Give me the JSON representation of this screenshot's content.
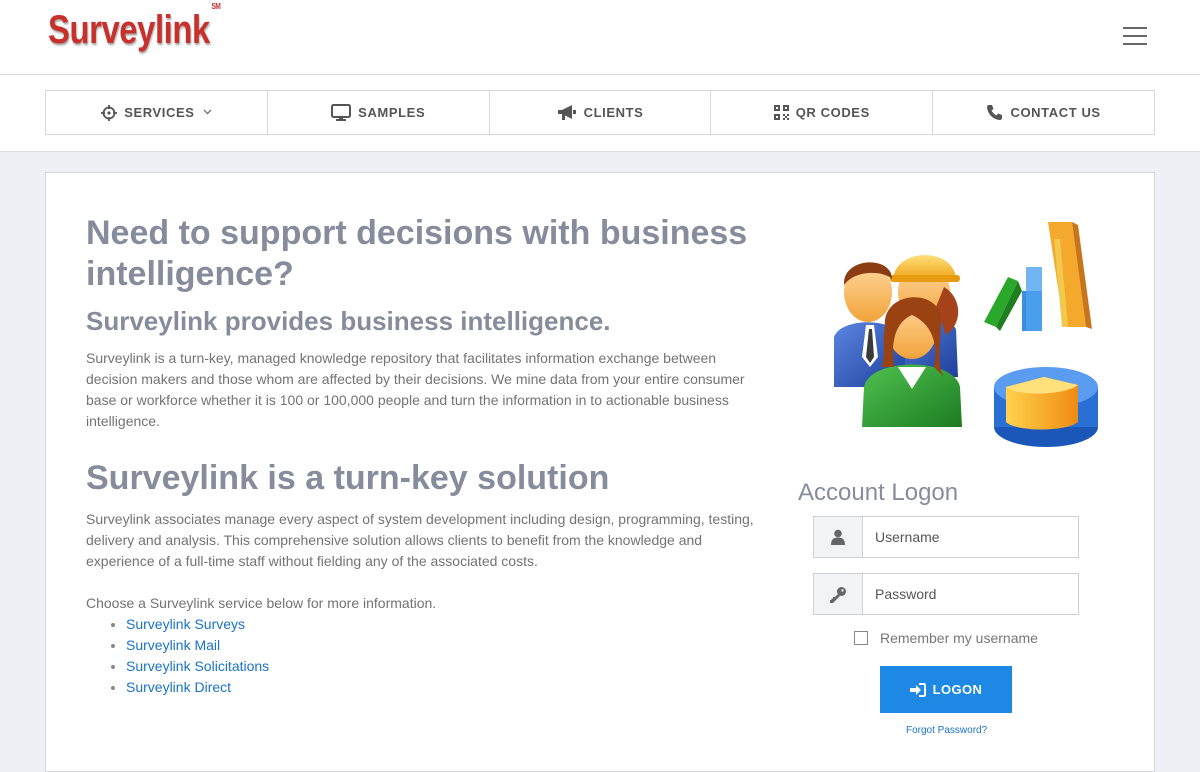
{
  "header": {
    "logo_text": "Surveylink",
    "logo_mark": "SM",
    "menu_icon": "hamburger-icon"
  },
  "nav": {
    "items": [
      {
        "label": "SERVICES",
        "icon": "crosshair-icon",
        "has_dropdown": true
      },
      {
        "label": "SAMPLES",
        "icon": "monitor-icon"
      },
      {
        "label": "CLIENTS",
        "icon": "megaphone-icon"
      },
      {
        "label": "QR CODES",
        "icon": "qrcode-icon"
      },
      {
        "label": "CONTACT US",
        "icon": "phone-icon"
      }
    ]
  },
  "main": {
    "heading": "Need to support decisions with business intelligence?",
    "subheading": "Surveylink provides business intelligence.",
    "intro": "Surveylink is a turn-key, managed knowledge repository that facilitates information exchange between decision makers and those whom are affected by their decisions. We mine data from your entire consumer base or workforce whether it is 100 or 100,000 people and turn the information in to actionable business intelligence.",
    "heading2": "Surveylink is a turn-key solution",
    "solution_text": "Surveylink associates manage every aspect of system development including design, programming, testing, delivery and analysis. This comprehensive solution allows clients to benefit from the knowledge and experience of a full-time staff without fielding any of the associated costs.",
    "choose_text": "Choose a Surveylink service below for more information.",
    "services": [
      "Surveylink Surveys",
      "Surveylink Mail",
      "Surveylink Solicitations",
      "Surveylink Direct"
    ]
  },
  "login": {
    "title": "Account Logon",
    "username_placeholder": "Username",
    "password_placeholder": "Password",
    "remember_label": "Remember my username",
    "logon_label": "LOGON",
    "forgot_label": "Forgot Password?"
  },
  "colors": {
    "logo": "#c8302c",
    "heading": "#868c9c",
    "link": "#1a73c9",
    "button": "#1e88e5"
  }
}
